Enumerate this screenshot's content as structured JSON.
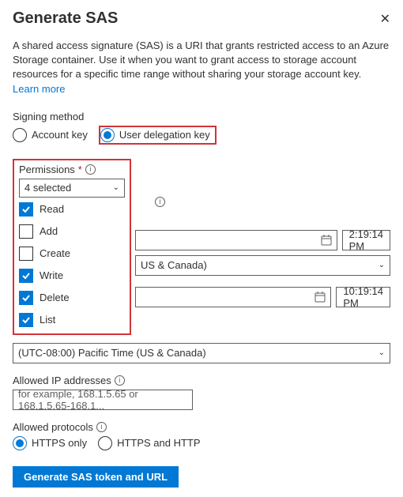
{
  "header": {
    "title": "Generate SAS"
  },
  "description": {
    "text": "A shared access signature (SAS) is a URI that grants restricted access to an Azure Storage container. Use it when you want to grant access to storage account resources for a specific time range without sharing your storage account key.",
    "learn_more": "Learn more"
  },
  "signing_method": {
    "label": "Signing method",
    "options": {
      "account_key": "Account key",
      "user_delegation_key": "User delegation key"
    },
    "selected": "user_delegation_key"
  },
  "permissions": {
    "label": "Permissions",
    "selected_summary": "4 selected",
    "options": [
      {
        "label": "Read",
        "checked": true
      },
      {
        "label": "Add",
        "checked": false
      },
      {
        "label": "Create",
        "checked": false
      },
      {
        "label": "Write",
        "checked": true
      },
      {
        "label": "Delete",
        "checked": true
      },
      {
        "label": "List",
        "checked": true
      }
    ]
  },
  "datetime": {
    "start_time": "2:19:14 PM",
    "expiry_time": "10:19:14 PM",
    "timezone_partial": "US & Canada)",
    "timezone_full": "(UTC-08:00) Pacific Time (US & Canada)"
  },
  "allowed_ip": {
    "label": "Allowed IP addresses",
    "placeholder": "for example, 168.1.5.65 or 168.1.5.65-168.1..."
  },
  "allowed_protocols": {
    "label": "Allowed protocols",
    "options": {
      "https_only": "HTTPS only",
      "https_http": "HTTPS and HTTP"
    },
    "selected": "https_only"
  },
  "action": {
    "generate": "Generate SAS token and URL"
  }
}
